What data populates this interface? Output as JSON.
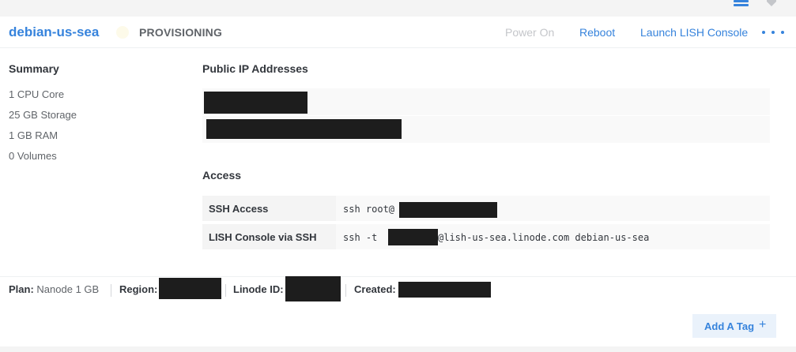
{
  "header": {
    "linode_name": "debian-us-sea",
    "status": "PROVISIONING",
    "actions": {
      "power_on": "Power On",
      "reboot": "Reboot",
      "lish": "Launch LISH Console"
    }
  },
  "summary": {
    "title": "Summary",
    "items": [
      "1 CPU Core",
      "25 GB Storage",
      "1 GB RAM",
      "0 Volumes"
    ]
  },
  "public_ips": {
    "title": "Public IP Addresses"
  },
  "access": {
    "title": "Access",
    "ssh_label": "SSH Access",
    "ssh_prefix": "ssh root@",
    "lish_label": "LISH Console via SSH",
    "lish_prefix": "ssh -t",
    "lish_suffix": "@lish-us-sea.linode.com debian-us-sea"
  },
  "footer": {
    "plan_label": "Plan:",
    "plan_value": "Nanode 1 GB",
    "region_label": "Region:",
    "linode_id_label": "Linode ID:",
    "created_label": "Created:"
  },
  "add_tag": {
    "label": "Add A Tag",
    "icon": "+"
  },
  "colors": {
    "accent": "#3683dc",
    "redaction": "#1d1d1d",
    "status_dot": "#fdfae9"
  }
}
